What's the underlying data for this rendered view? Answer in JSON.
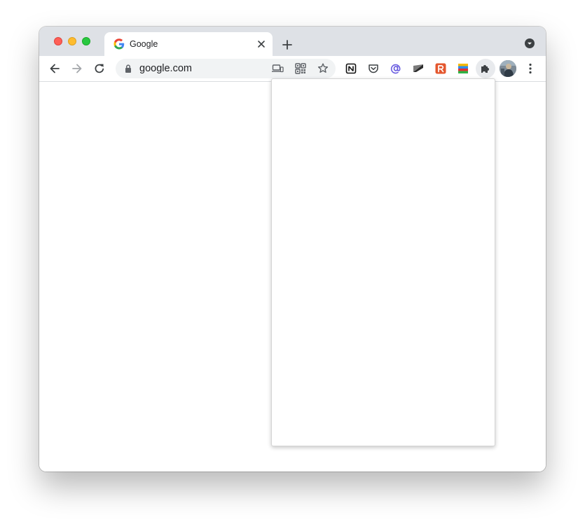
{
  "browser": {
    "tab": {
      "title": "Google",
      "favicon": "google-favicon-icon"
    },
    "omnibox": {
      "url": "google.com"
    },
    "colors": {
      "tabstrip": "#dee1e6",
      "toolbar": "#ffffff",
      "omnibox": "#f1f3f4",
      "traffic_close": "#fe5f57",
      "traffic_minimize": "#febc2e",
      "traffic_maximize": "#28c840"
    },
    "extensions": [
      "notion-icon",
      "pocket-icon",
      "mention-icon",
      "stripe-flag-icon",
      "raindrop-icon",
      "color-blocks-icon"
    ]
  }
}
